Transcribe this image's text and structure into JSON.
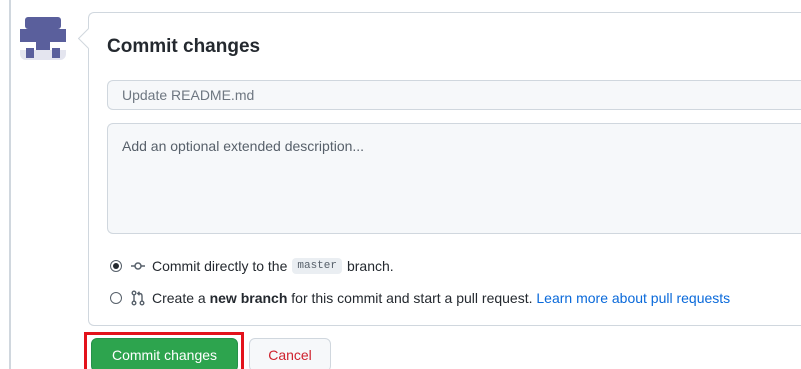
{
  "commit_form": {
    "title": "Commit changes",
    "summary_placeholder": "Update README.md",
    "description_placeholder": "Add an optional extended description...",
    "options": {
      "direct": {
        "before": "Commit directly to the",
        "branch_name": "master",
        "after": "branch.",
        "selected": true,
        "icon": "git-commit-icon"
      },
      "new_branch": {
        "prefix": "Create a",
        "emphasis": "new branch",
        "suffix": "for this commit and start a pull request.",
        "link_text": "Learn more about pull requests",
        "selected": false,
        "icon": "git-pull-request-icon"
      }
    },
    "buttons": {
      "commit_label": "Commit changes",
      "cancel_label": "Cancel"
    }
  },
  "colors": {
    "primary_button": "#2da44e",
    "cancel_text": "#cf222e",
    "link": "#0969da",
    "highlight_border": "#e3121b"
  }
}
